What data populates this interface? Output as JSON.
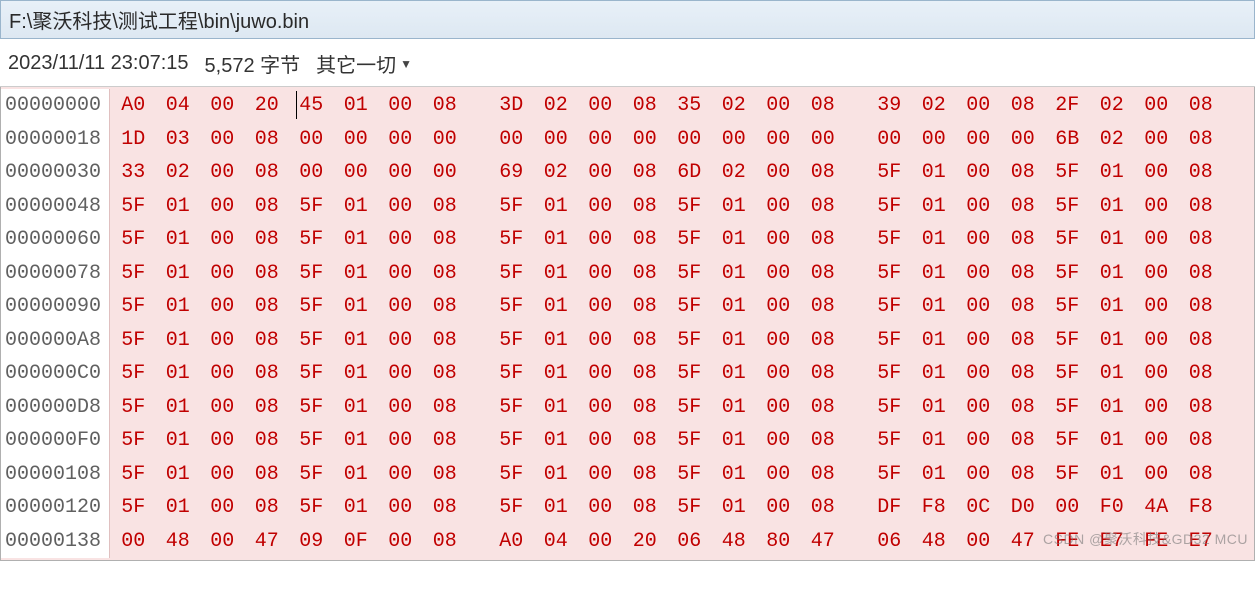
{
  "title_bar": {
    "path": "F:\\聚沃科技\\测试工程\\bin\\juwo.bin"
  },
  "info_bar": {
    "timestamp": "2023/11/11 23:07:15",
    "size": "5,572 字节",
    "encoding_label": "其它一切"
  },
  "watermark": "CSDN @聚沃科技&GD32 MCU",
  "hex": {
    "rows": [
      {
        "offset": "00000000",
        "bytes": [
          "A0",
          "04",
          "00",
          "20",
          "45",
          "01",
          "00",
          "08",
          "3D",
          "02",
          "00",
          "08",
          "35",
          "02",
          "00",
          "08",
          "39",
          "02",
          "00",
          "08",
          "2F",
          "02",
          "00",
          "08"
        ]
      },
      {
        "offset": "00000018",
        "bytes": [
          "1D",
          "03",
          "00",
          "08",
          "00",
          "00",
          "00",
          "00",
          "00",
          "00",
          "00",
          "00",
          "00",
          "00",
          "00",
          "00",
          "00",
          "00",
          "00",
          "00",
          "6B",
          "02",
          "00",
          "08"
        ]
      },
      {
        "offset": "00000030",
        "bytes": [
          "33",
          "02",
          "00",
          "08",
          "00",
          "00",
          "00",
          "00",
          "69",
          "02",
          "00",
          "08",
          "6D",
          "02",
          "00",
          "08",
          "5F",
          "01",
          "00",
          "08",
          "5F",
          "01",
          "00",
          "08"
        ]
      },
      {
        "offset": "00000048",
        "bytes": [
          "5F",
          "01",
          "00",
          "08",
          "5F",
          "01",
          "00",
          "08",
          "5F",
          "01",
          "00",
          "08",
          "5F",
          "01",
          "00",
          "08",
          "5F",
          "01",
          "00",
          "08",
          "5F",
          "01",
          "00",
          "08"
        ]
      },
      {
        "offset": "00000060",
        "bytes": [
          "5F",
          "01",
          "00",
          "08",
          "5F",
          "01",
          "00",
          "08",
          "5F",
          "01",
          "00",
          "08",
          "5F",
          "01",
          "00",
          "08",
          "5F",
          "01",
          "00",
          "08",
          "5F",
          "01",
          "00",
          "08"
        ]
      },
      {
        "offset": "00000078",
        "bytes": [
          "5F",
          "01",
          "00",
          "08",
          "5F",
          "01",
          "00",
          "08",
          "5F",
          "01",
          "00",
          "08",
          "5F",
          "01",
          "00",
          "08",
          "5F",
          "01",
          "00",
          "08",
          "5F",
          "01",
          "00",
          "08"
        ]
      },
      {
        "offset": "00000090",
        "bytes": [
          "5F",
          "01",
          "00",
          "08",
          "5F",
          "01",
          "00",
          "08",
          "5F",
          "01",
          "00",
          "08",
          "5F",
          "01",
          "00",
          "08",
          "5F",
          "01",
          "00",
          "08",
          "5F",
          "01",
          "00",
          "08"
        ]
      },
      {
        "offset": "000000A8",
        "bytes": [
          "5F",
          "01",
          "00",
          "08",
          "5F",
          "01",
          "00",
          "08",
          "5F",
          "01",
          "00",
          "08",
          "5F",
          "01",
          "00",
          "08",
          "5F",
          "01",
          "00",
          "08",
          "5F",
          "01",
          "00",
          "08"
        ]
      },
      {
        "offset": "000000C0",
        "bytes": [
          "5F",
          "01",
          "00",
          "08",
          "5F",
          "01",
          "00",
          "08",
          "5F",
          "01",
          "00",
          "08",
          "5F",
          "01",
          "00",
          "08",
          "5F",
          "01",
          "00",
          "08",
          "5F",
          "01",
          "00",
          "08"
        ]
      },
      {
        "offset": "000000D8",
        "bytes": [
          "5F",
          "01",
          "00",
          "08",
          "5F",
          "01",
          "00",
          "08",
          "5F",
          "01",
          "00",
          "08",
          "5F",
          "01",
          "00",
          "08",
          "5F",
          "01",
          "00",
          "08",
          "5F",
          "01",
          "00",
          "08"
        ]
      },
      {
        "offset": "000000F0",
        "bytes": [
          "5F",
          "01",
          "00",
          "08",
          "5F",
          "01",
          "00",
          "08",
          "5F",
          "01",
          "00",
          "08",
          "5F",
          "01",
          "00",
          "08",
          "5F",
          "01",
          "00",
          "08",
          "5F",
          "01",
          "00",
          "08"
        ]
      },
      {
        "offset": "00000108",
        "bytes": [
          "5F",
          "01",
          "00",
          "08",
          "5F",
          "01",
          "00",
          "08",
          "5F",
          "01",
          "00",
          "08",
          "5F",
          "01",
          "00",
          "08",
          "5F",
          "01",
          "00",
          "08",
          "5F",
          "01",
          "00",
          "08"
        ]
      },
      {
        "offset": "00000120",
        "bytes": [
          "5F",
          "01",
          "00",
          "08",
          "5F",
          "01",
          "00",
          "08",
          "5F",
          "01",
          "00",
          "08",
          "5F",
          "01",
          "00",
          "08",
          "DF",
          "F8",
          "0C",
          "D0",
          "00",
          "F0",
          "4A",
          "F8"
        ]
      },
      {
        "offset": "00000138",
        "bytes": [
          "00",
          "48",
          "00",
          "47",
          "09",
          "0F",
          "00",
          "08",
          "A0",
          "04",
          "00",
          "20",
          "06",
          "48",
          "80",
          "47",
          "06",
          "48",
          "00",
          "47",
          "FE",
          "E7",
          "FE",
          "E7"
        ]
      }
    ]
  }
}
